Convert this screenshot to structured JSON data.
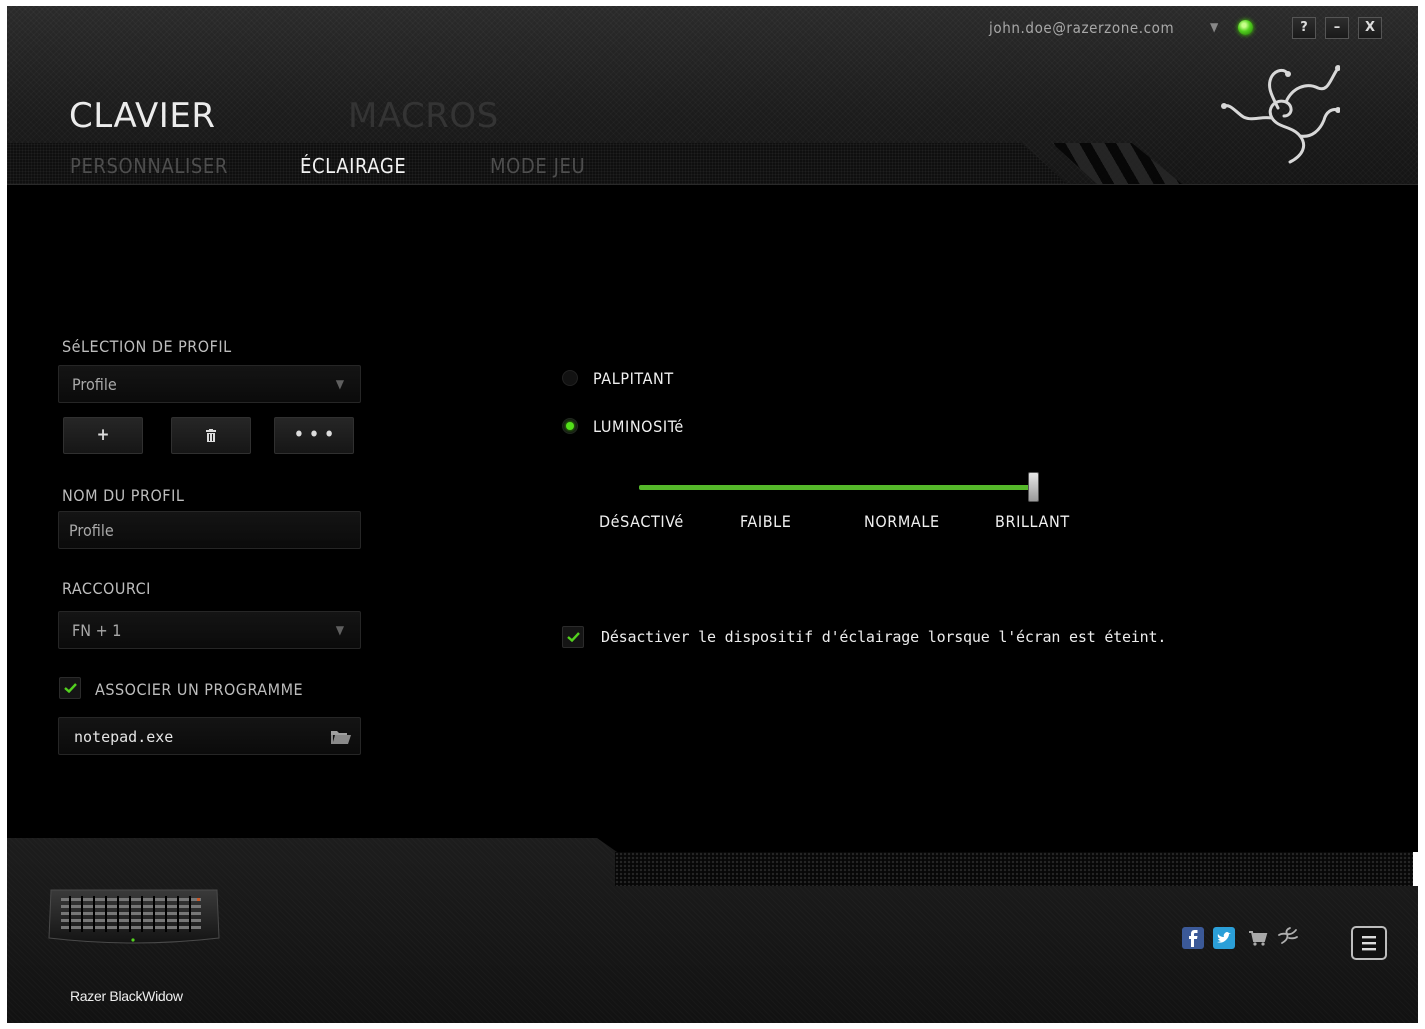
{
  "window": {
    "user_email": "john.doe@razerzone.com",
    "buttons": {
      "help": "?",
      "minimize": "–",
      "close": "X"
    },
    "accent_color": "#44d600"
  },
  "nav": {
    "main_tabs": [
      {
        "label": "CLAVIER",
        "active": true
      },
      {
        "label": "MACROS",
        "active": false
      }
    ],
    "sub_tabs": [
      {
        "label": "PERSONNALISER",
        "active": false
      },
      {
        "label": "ÉCLAIRAGE",
        "active": true
      },
      {
        "label": "MODE JEU",
        "active": false
      }
    ]
  },
  "profile_panel": {
    "selection_label": "SéLECTION DE PROFIL",
    "selected_profile": "Profile",
    "buttons": {
      "add": "+",
      "more": "• • •"
    },
    "name_label": "NOM DU PROFIL",
    "name_value": "Profile",
    "shortcut_label": "RACCOURCI",
    "shortcut_value": "FN + 1",
    "associate_label": "ASSOCIER UN PROGRAMME",
    "associate_checked": true,
    "program_value": "notepad.exe"
  },
  "lighting": {
    "options": [
      {
        "label": "PALPITANT",
        "selected": false
      },
      {
        "label": "LUMINOSITé",
        "selected": true
      }
    ],
    "brightness": {
      "levels": [
        "DéSACTIVé",
        "FAIBLE",
        "NORMALE",
        "BRILLANT"
      ],
      "current_index": 3
    },
    "screen_off_label": "Désactiver le dispositif d'éclairage lorsque l'écran est éteint.",
    "screen_off_checked": true
  },
  "footer": {
    "device_name": "Razer BlackWidow",
    "icons": [
      "facebook-icon",
      "twitter-icon",
      "cart-icon",
      "razer-icon",
      "menu-icon"
    ]
  }
}
